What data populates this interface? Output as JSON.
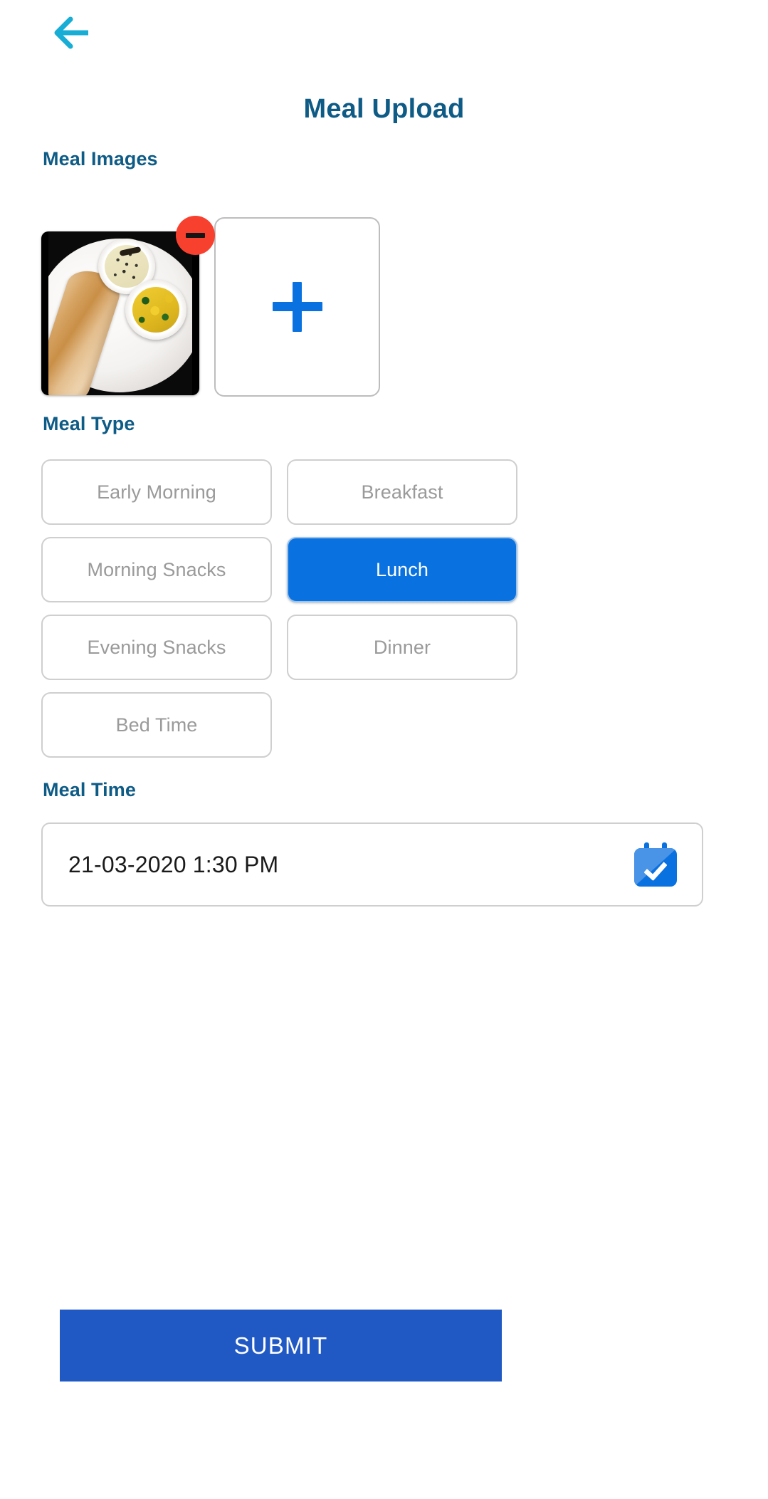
{
  "header": {
    "back_icon": "back-arrow-icon",
    "title": "Meal Upload",
    "title_color": "#0e5b86",
    "back_arrow_color": "#17add4"
  },
  "meal_images": {
    "label": "Meal Images",
    "thumbnails": [
      {
        "alt": "South Indian dosa meal with chutney and potato sabzi on a white plate",
        "remove_icon": "minus-circle-remove-icon",
        "remove_badge_color": "#f8402f"
      }
    ],
    "add_tile": {
      "icon": "plus-icon",
      "icon_color": "#0a72e0"
    }
  },
  "meal_type": {
    "label": "Meal Type",
    "selected": "Lunch",
    "selected_color": "#0a72e0",
    "unselected_text_color": "#9a9a9a",
    "rows": [
      [
        "Early Morning",
        "Breakfast"
      ],
      [
        "Morning Snacks",
        "Lunch"
      ],
      [
        "Evening Snacks",
        "Dinner"
      ],
      [
        "Bed Time"
      ]
    ]
  },
  "meal_time": {
    "label": "Meal Time",
    "value": "21-03-2020 1:30 PM",
    "calendar_icon": "calendar-check-icon",
    "calendar_icon_color": "#0a72e0"
  },
  "submit": {
    "label": "SUBMIT",
    "color": "#2159c4"
  }
}
